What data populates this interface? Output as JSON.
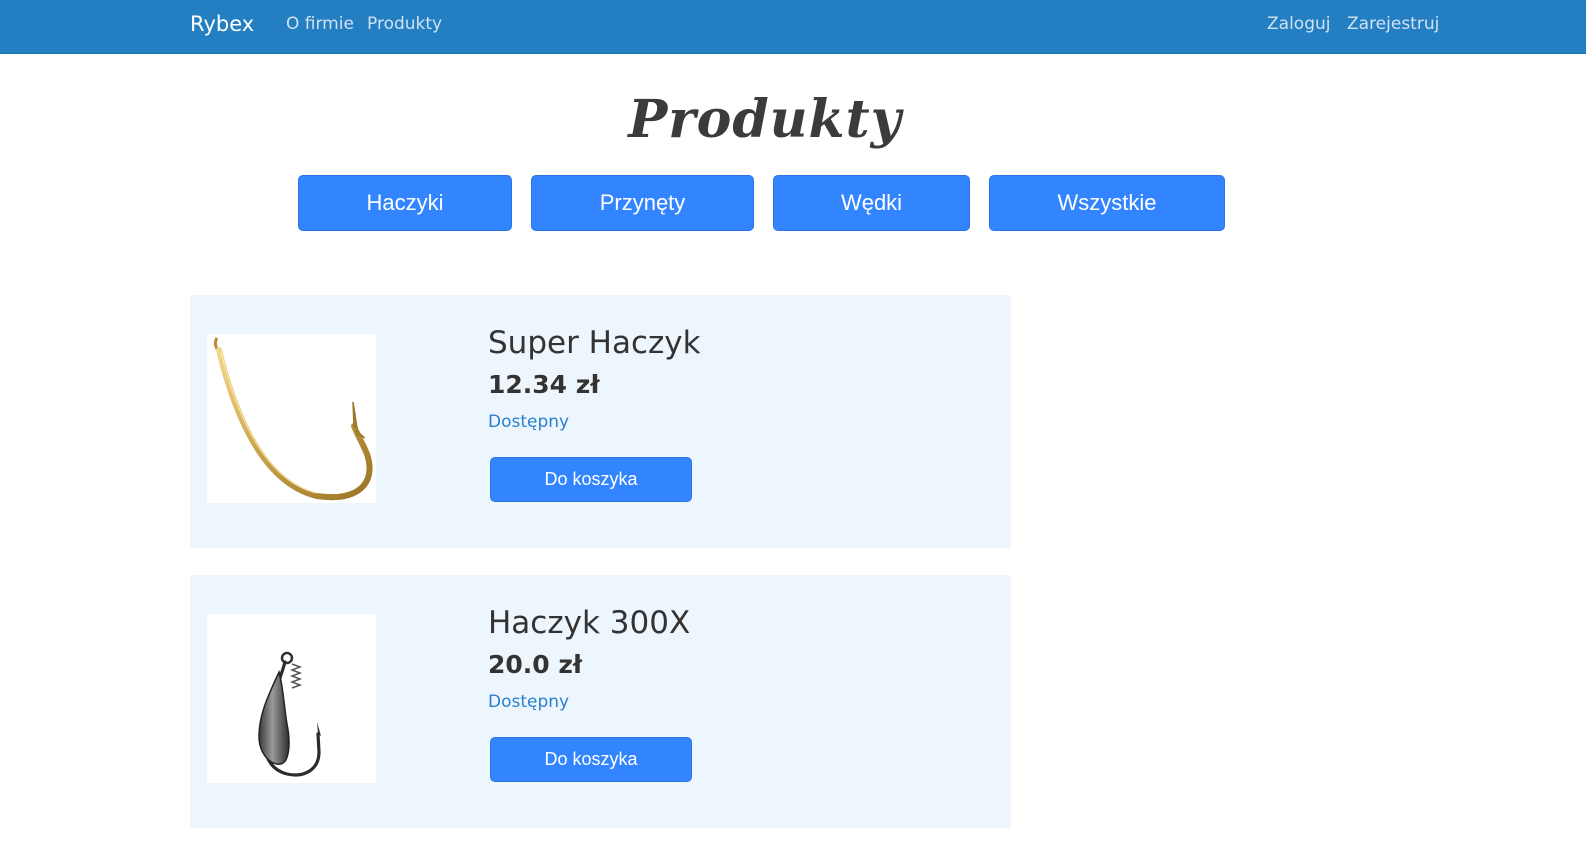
{
  "navbar": {
    "brand": "Rybex",
    "left_links": [
      {
        "label": "O firmie"
      },
      {
        "label": "Produkty"
      }
    ],
    "right_links": [
      {
        "label": "Zaloguj"
      },
      {
        "label": "Zarejestruj"
      }
    ],
    "background_color": "#247ec2"
  },
  "page": {
    "title": "Produkty"
  },
  "categories": [
    {
      "label": "Haczyki"
    },
    {
      "label": "Przynęty"
    },
    {
      "label": "Wędki"
    },
    {
      "label": "Wszystkie"
    }
  ],
  "products": [
    {
      "name": "Super Haczyk",
      "price": "12.34 zł",
      "status": "Dostępny",
      "button_label": "Do koszyka",
      "image_icon": "gold-fishing-hook-icon"
    },
    {
      "name": "Haczyk 300X",
      "price": "20.0 zł",
      "status": "Dostępny",
      "button_label": "Do koszyka",
      "image_icon": "weighted-fishing-hook-icon"
    }
  ],
  "colors": {
    "accent": "#3385ff",
    "card_background": "#eef6fd",
    "status": "#2a7fd0"
  }
}
